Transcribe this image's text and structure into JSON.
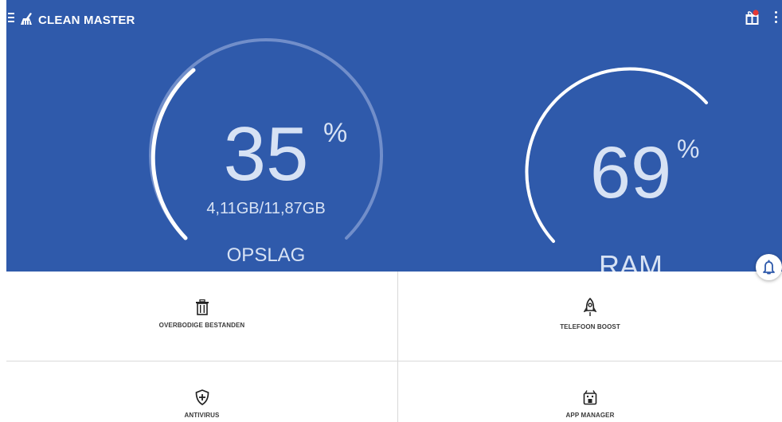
{
  "app": {
    "title": "CLEAN MASTER"
  },
  "colors": {
    "hero_bg": "#2f5aab",
    "gauge_text": "#d7e2f4",
    "badge": "#e53935",
    "fab_icon": "#2f5aab"
  },
  "icons": {
    "menu": "menu-icon",
    "brand": "broom-icon",
    "gift": "gift-icon",
    "more": "more-vert-icon",
    "trash": "trash-icon",
    "rocket": "rocket-icon",
    "shield": "shield-plus-icon",
    "app": "app-manager-icon",
    "bell": "bell-icon"
  },
  "storage": {
    "value": "35",
    "percent_sign": "%",
    "detail": "4,11GB/11,87GB",
    "label": "OPSLAG",
    "fill_fraction": 0.35
  },
  "ram": {
    "value": "69",
    "percent_sign": "%",
    "label": "RAM",
    "fill_fraction": 0.69
  },
  "tiles": [
    {
      "label": "OVERBODIGE BESTANDEN"
    },
    {
      "label": "TELEFOON BOOST"
    },
    {
      "label": "ANTIVIRUS"
    },
    {
      "label": "APP MANAGER"
    }
  ]
}
